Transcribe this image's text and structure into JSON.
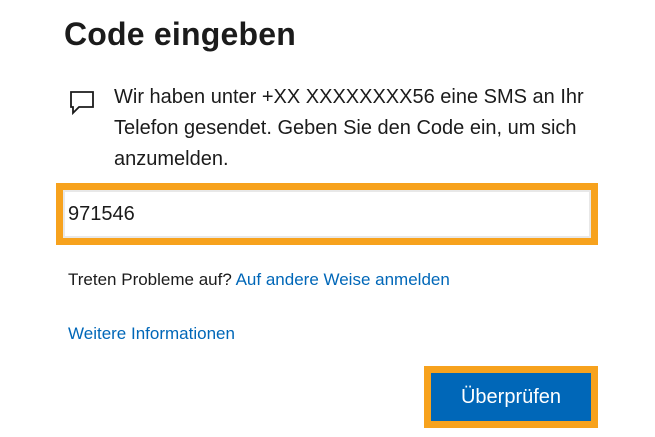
{
  "header": {
    "title": "Code eingeben"
  },
  "message": {
    "icon": "chat-bubble-icon",
    "text": "Wir haben unter +XX XXXXXXXX56 eine SMS an Ihr Telefon gesendet. Geben Sie den Code ein, um sich anzumelden."
  },
  "code_input": {
    "value": "971546"
  },
  "problems": {
    "question": "Treten Probleme auf?",
    "link_label": "Auf andere Weise anmelden"
  },
  "more_info": {
    "label": "Weitere Informationen"
  },
  "actions": {
    "verify_label": "Überprüfen"
  },
  "colors": {
    "accent": "#0067b8",
    "highlight": "#f7a21d",
    "text": "#1b1b1b"
  }
}
